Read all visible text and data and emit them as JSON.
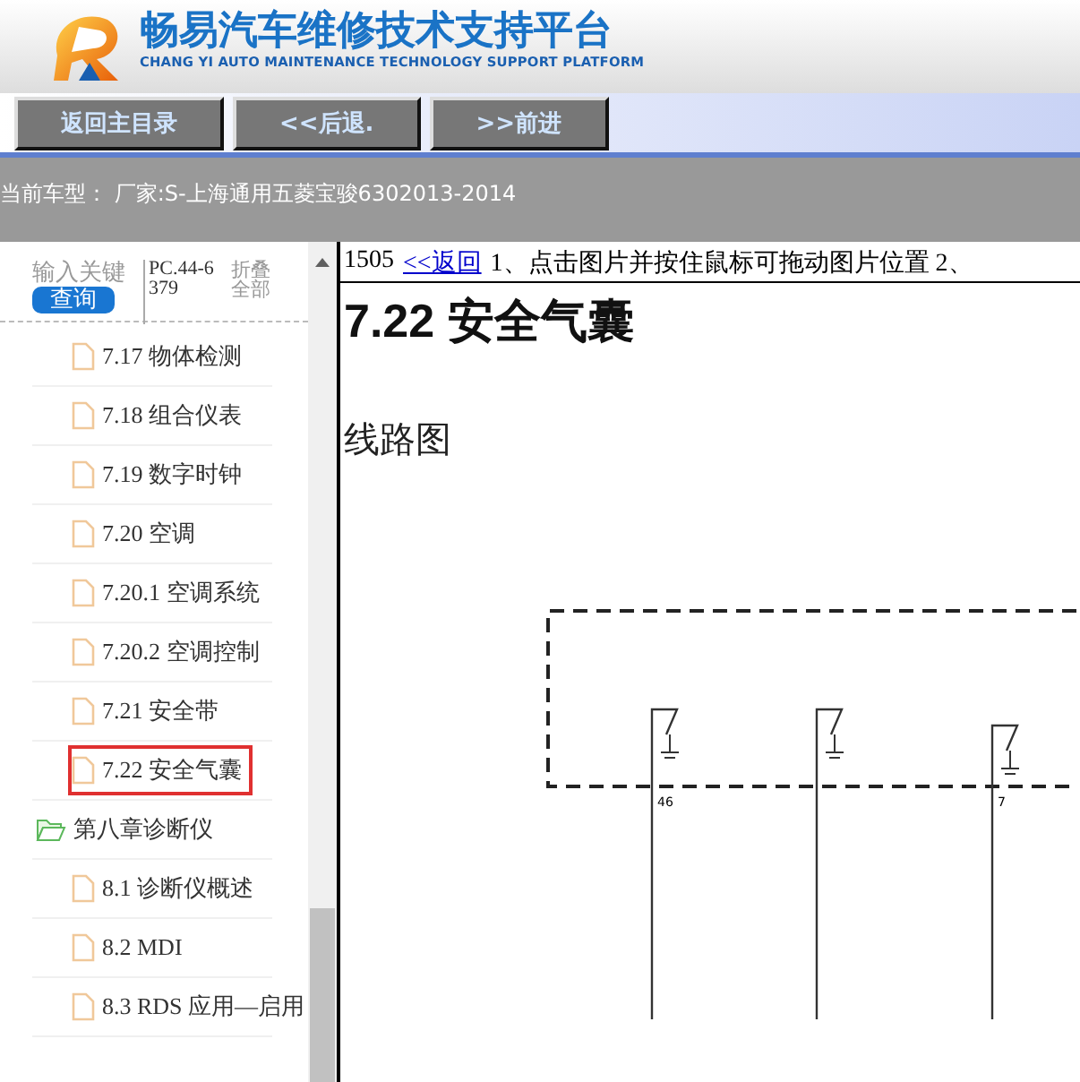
{
  "header": {
    "title": "畅易汽车维修技术支持平台",
    "subtitle": "CHANG YI AUTO MAINTENANCE TECHNOLOGY SUPPORT PLATFORM"
  },
  "nav_buttons": [
    "返回主目录",
    "<<后退.",
    ">>前进"
  ],
  "current_model": "当前车型： 厂家:S-上海通用五菱宝骏6302013-2014",
  "sidebar": {
    "search": {
      "placeholder": "输入关键"
    },
    "search_button": "查询",
    "code": "PC.44-6379",
    "collapse_all": "折叠全部",
    "tree": [
      {
        "kind": "group",
        "children": [
          {
            "kind": "file",
            "label": "7.17 物体检测",
            "selected": false
          },
          {
            "kind": "file",
            "label": "7.18 组合仪表",
            "selected": false
          },
          {
            "kind": "file",
            "label": "7.19 数字时钟",
            "selected": false
          },
          {
            "kind": "file",
            "label": "7.20 空调",
            "selected": false
          },
          {
            "kind": "file",
            "label": "7.20.1 空调系统",
            "selected": false
          },
          {
            "kind": "file",
            "label": "7.20.2 空调控制",
            "selected": false
          },
          {
            "kind": "file",
            "label": "7.21 安全带",
            "selected": false
          },
          {
            "kind": "file",
            "label": "7.22 安全气囊",
            "selected": true
          }
        ]
      },
      {
        "kind": "folder",
        "label": "第八章诊断仪",
        "selected": false,
        "children": [
          {
            "kind": "file",
            "label": "8.1 诊断仪概述",
            "selected": false
          },
          {
            "kind": "file",
            "label": "8.2 MDI",
            "selected": false
          },
          {
            "kind": "file",
            "label": "8.3 RDS 应用—启用",
            "selected": false
          }
        ]
      }
    ]
  },
  "content": {
    "page_number": "1505",
    "back_link": "<<返回",
    "instructions": "1、点击图片并按住鼠标可拖动图片位置 2、",
    "heading": "7.22 安全气囊",
    "section": "线路图",
    "diagram": {
      "pin_labels": [
        "46",
        "7"
      ]
    }
  }
}
